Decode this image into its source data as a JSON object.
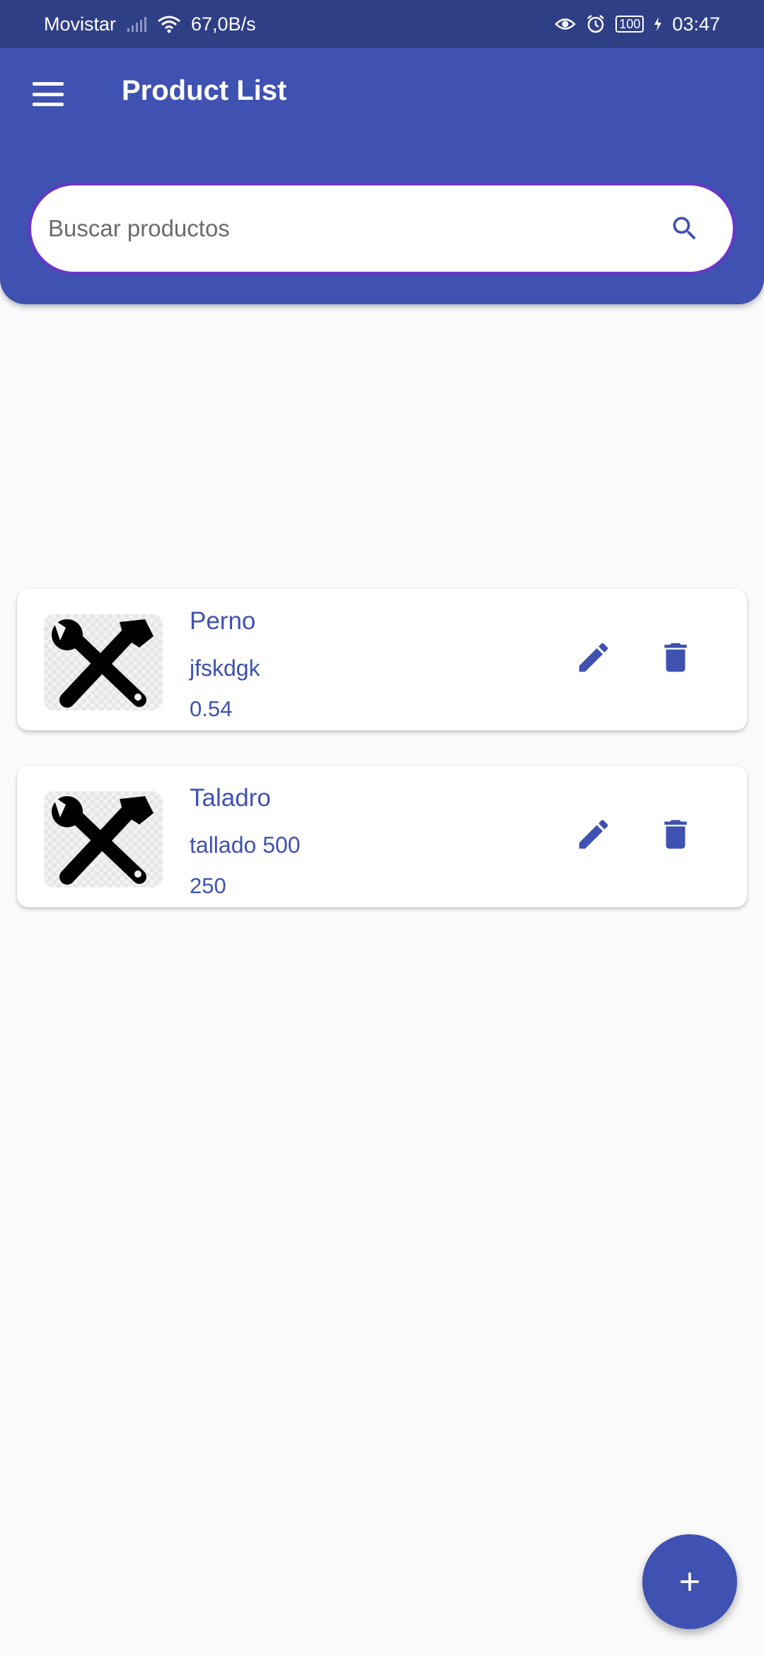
{
  "status_bar": {
    "carrier": "Movistar",
    "net_speed": "67,0B/s",
    "battery": "100",
    "time": "03:47"
  },
  "header": {
    "title": "Product List",
    "menu_icon": "hamburger-menu-icon"
  },
  "search": {
    "placeholder": "Buscar productos",
    "value": "",
    "icon": "search-icon"
  },
  "products": [
    {
      "name": "Perno",
      "description": "jfskdgk",
      "price": "0.54",
      "image_icon": "tools-icon"
    },
    {
      "name": "Taladro",
      "description": "tallado 500",
      "price": "250",
      "image_icon": "tools-icon"
    }
  ],
  "fab": {
    "icon": "plus-icon"
  },
  "colors": {
    "primary": "#3f51b1",
    "status_bar": "#2f3f86",
    "search_border": "#6a35c8",
    "background": "#fafafa"
  }
}
